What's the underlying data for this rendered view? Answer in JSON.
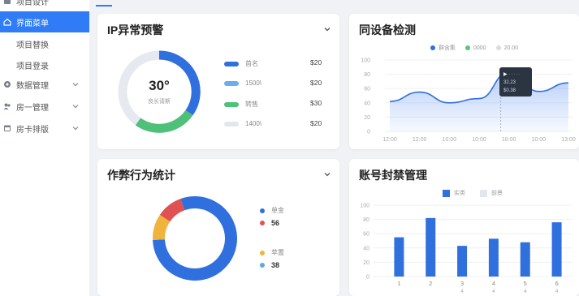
{
  "sidebar": {
    "top_partial": "项目设计",
    "active_item": "界面菜单",
    "sub_items": [
      "项目替换",
      "项目登录"
    ],
    "items": [
      {
        "label": "数据管理"
      },
      {
        "label": "房一管理"
      },
      {
        "label": "房卡排版"
      }
    ]
  },
  "ip_alert": {
    "title": "IP异常预警",
    "center_value": "30°",
    "center_sub": "良长请斯",
    "legend": [
      {
        "label": "首名",
        "value": "$20",
        "color": "#2f6fde"
      },
      {
        "label": "1500\\",
        "value": "$20",
        "color": "#6aaef0"
      },
      {
        "label": "转售",
        "value": "$30",
        "color": "#4fc07a"
      },
      {
        "label": "1400\\",
        "value": "$20",
        "color": "#e3e6ec"
      }
    ]
  },
  "device": {
    "title": "同设备检测",
    "legend": [
      {
        "label": "群含集",
        "color": "#2f6fde"
      },
      {
        "label": "0000",
        "color": "#5ac47c"
      },
      {
        "label": "20.00",
        "color": "#d8dbe0"
      }
    ],
    "tooltip": {
      "line1": "32.23",
      "line2": "$0.38"
    },
    "chart_data": {
      "type": "area",
      "x": [
        "12:00",
        "12:00",
        "10:00",
        "10:00",
        "10:00",
        "10:00",
        "13:00"
      ],
      "ylim": [
        0,
        100
      ],
      "yticks": [
        "100",
        "80",
        "60",
        "40",
        "20",
        "0"
      ],
      "series": [
        {
          "values": [
            42,
            55,
            40,
            46,
            83,
            56,
            68
          ]
        }
      ]
    }
  },
  "cheat": {
    "title": "作弊行为统计",
    "legend": [
      {
        "label": "单金",
        "value": "",
        "color": "#2f6fde"
      },
      {
        "label": "",
        "value": "56",
        "color": "#e05151"
      },
      {
        "label": "苹置",
        "value": "",
        "color": "#f0b43c"
      },
      {
        "label": "",
        "value": "38",
        "color": "#5aa8ee"
      }
    ],
    "chart_data": {
      "type": "pie",
      "values": [
        80,
        10,
        10
      ],
      "colors": [
        "#2f6fde",
        "#f0b43c",
        "#e05151"
      ]
    }
  },
  "ban": {
    "title": "账号封禁管理",
    "legend": [
      {
        "label": "实类",
        "color": "#2f6fde"
      },
      {
        "label": "前景",
        "color": "#e3e6ec"
      }
    ],
    "chart_data": {
      "type": "bar",
      "categories": [
        "1",
        "2",
        "3",
        "4",
        "5",
        "6"
      ],
      "category_sublabels": [
        "",
        "",
        "4",
        "4",
        "4",
        "4"
      ],
      "values": [
        55,
        82,
        43,
        53,
        48,
        76
      ],
      "ylim": [
        0,
        100
      ],
      "yticks": [
        "100",
        "80",
        "60",
        "40",
        "20",
        "0"
      ]
    }
  }
}
